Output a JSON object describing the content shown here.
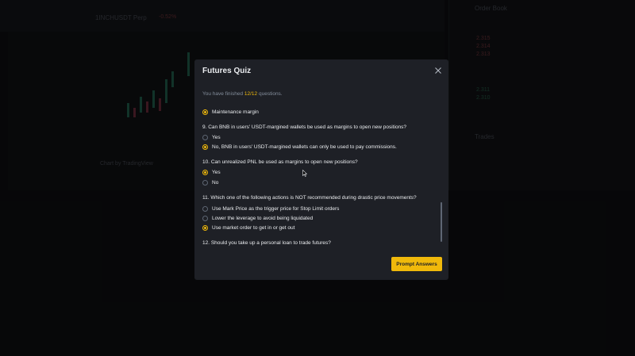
{
  "background": {
    "pair": "1INCHUSDT Perp",
    "chart_watermark": "Chart by TradingView",
    "order_book_title": "Order Book",
    "trades_title": "Trades"
  },
  "modal": {
    "title": "Futures Quiz",
    "progress_prefix": "You have finished ",
    "progress_count": "12/12",
    "progress_suffix": " questions.",
    "prompt_button": "Prompt Answers"
  },
  "quiz": {
    "q8_option": "Maintenance margin",
    "q9": {
      "question": "9. Can BNB in users' USDT-margined wallets be used as margins to open new positions?",
      "options": [
        "Yes",
        "No, BNB in users' USDT-margined wallets can only be used to pay commissions."
      ]
    },
    "q10": {
      "question": "10. Can unrealized PNL be used as margins to open new positions?",
      "options": [
        "Yes",
        "No"
      ]
    },
    "q11": {
      "question": "11. Which one of the following actions is NOT recommended during drastic price movements?",
      "options": [
        "Use Mark Price as the trigger price for Stop Limit orders",
        "Lower the leverage to avoid being liquidated",
        "Use market order to get in or get out"
      ]
    },
    "q12": {
      "question": "12. Should you take up a personal loan to trade futures?"
    }
  },
  "colors": {
    "accent": "#f0b90b",
    "modal_bg": "#1e2026",
    "text": "#eaecef",
    "muted": "#848e9c"
  }
}
